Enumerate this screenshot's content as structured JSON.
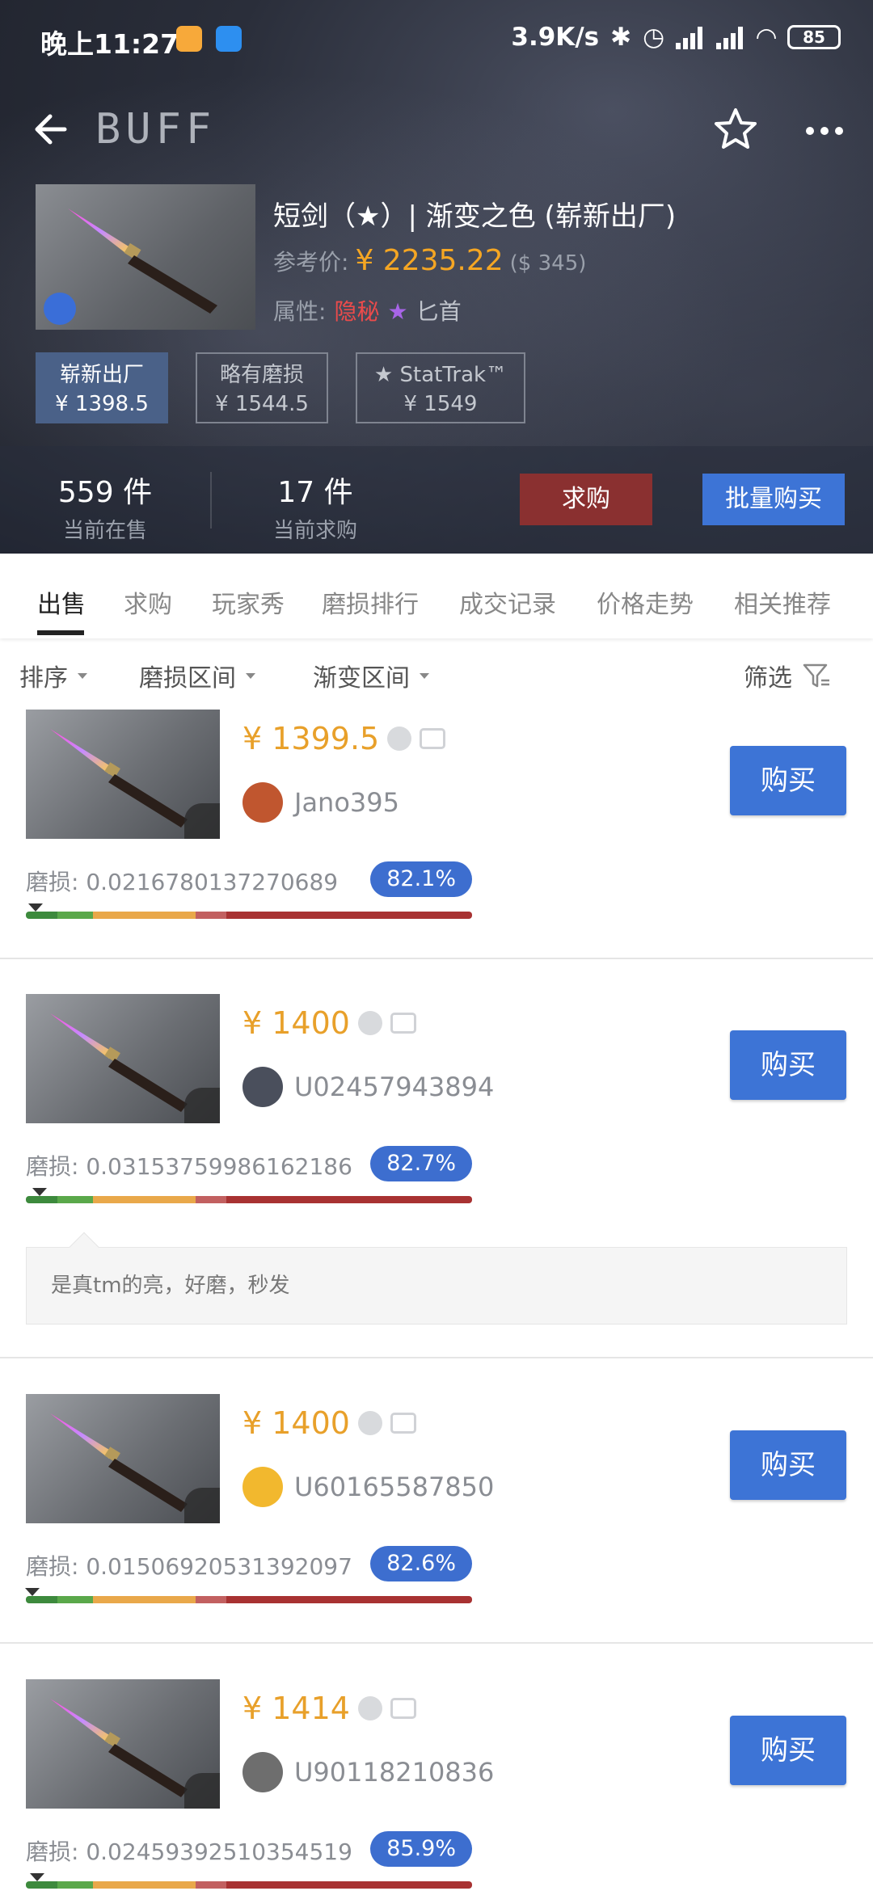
{
  "status": {
    "time": "晚上11:27",
    "speed": "3.9K/s",
    "battery": "85"
  },
  "nav": {
    "logo": "BUFF"
  },
  "item": {
    "title": "短剑（★）| 渐变之色 (崭新出厂)",
    "ref_price_label": "参考价:",
    "ref_price": "¥ 2235.22",
    "ref_usd": "($ 345)",
    "attr_label": "属性:",
    "attr_rarity": "隐秘",
    "attr_star": "★",
    "attr_type": "匕首"
  },
  "wear_tabs": [
    {
      "name": "崭新出厂",
      "price": "¥ 1398.5"
    },
    {
      "name": "略有磨损",
      "price": "¥ 1544.5"
    },
    {
      "name": "★ StatTrak™",
      "price": "¥ 1549"
    }
  ],
  "stats": {
    "on_sale_num": "559 件",
    "on_sale_label": "当前在售",
    "buying_num": "17 件",
    "buying_label": "当前求购",
    "buy_order_btn": "求购",
    "bulk_buy_btn": "批量购买"
  },
  "tabs": [
    "出售",
    "求购",
    "玩家秀",
    "磨损排行",
    "成交记录",
    "价格走势",
    "相关推荐"
  ],
  "filters": {
    "sort": "排序",
    "wear_range": "磨损区间",
    "fade_range": "渐变区间",
    "filter": "筛选"
  },
  "wear_label": "磨损:",
  "buy_label": "购买",
  "listings": [
    {
      "price": "¥ 1399.5",
      "seller": "Jano395",
      "wear": "0.0216780137270689",
      "fade": "82.1%",
      "wear_fraction": 0.0217
    },
    {
      "price": "¥ 1400",
      "seller": "U02457943894",
      "wear": "0.03153759986162186",
      "fade": "82.7%",
      "wear_fraction": 0.0315,
      "note": "是真tm的亮，好磨，秒发"
    },
    {
      "price": "¥ 1400",
      "seller": "U60165587850",
      "wear": "0.01506920531392097",
      "fade": "82.6%",
      "wear_fraction": 0.0151
    },
    {
      "price": "¥ 1414",
      "seller": "U90118210836",
      "wear": "0.02459392510354519",
      "fade": "85.9%",
      "wear_fraction": 0.0246
    }
  ],
  "colors": {
    "accent_blue": "#3d74d6",
    "price_orange": "#e8a02a",
    "rarity_red": "#eb4b4b",
    "buy_order_red": "#8a3030"
  }
}
